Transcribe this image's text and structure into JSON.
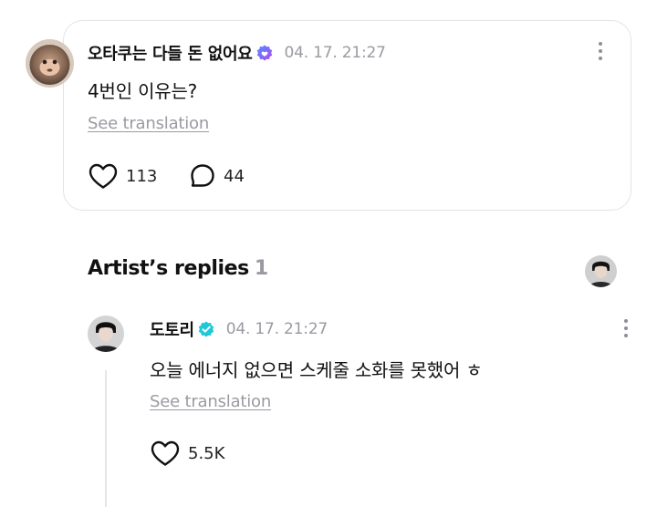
{
  "post": {
    "username": "오타쿠는 다들 돈 없어요",
    "timestamp": "04. 17. 21:27",
    "text": "4번인 이유는?",
    "translate_label": "See translation",
    "likes": "113",
    "comments": "44"
  },
  "artist_section": {
    "title": "Artist’s replies",
    "count": "1"
  },
  "reply": {
    "username": "도토리",
    "timestamp": "04. 17. 21:27",
    "text": "오늘 에너지 없으면 스케줄 소화를 못했어 ㅎ",
    "translate_label": "See translation",
    "likes": "5.5K"
  },
  "colors": {
    "post_verify": "#7a5cf0",
    "artist_verify": "#1ec8d8",
    "muted_text": "#9a9aa2"
  },
  "icons": [
    "user-avatar",
    "verified-badge-icon",
    "more-icon",
    "heart-icon",
    "comment-icon",
    "artist-avatar"
  ]
}
